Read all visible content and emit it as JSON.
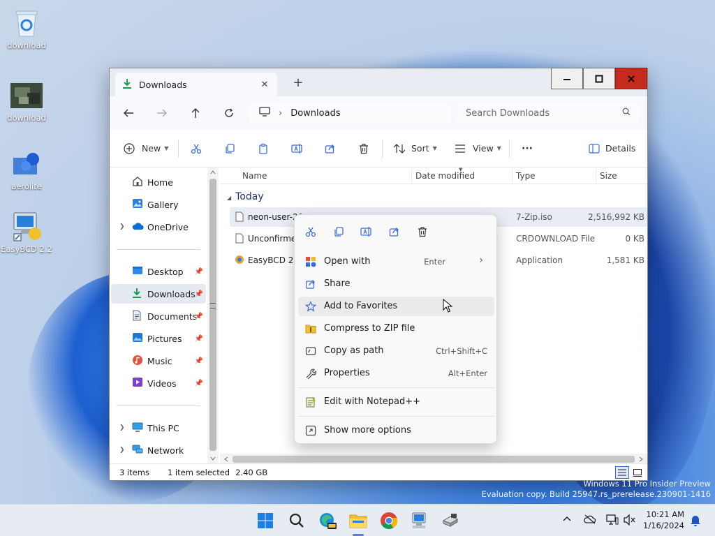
{
  "desktop": {
    "icons": [
      {
        "label": "download"
      },
      {
        "label": "download"
      },
      {
        "label": "aerolite"
      },
      {
        "label": "EasyBCD 2.2"
      }
    ],
    "watermark_line1": "Windows 11 Pro Insider Preview",
    "watermark_line2": "Evaluation copy. Build 25947.rs_prerelease.230901-1416"
  },
  "window": {
    "tab_title": "Downloads",
    "new_tab_label": "+",
    "address": {
      "crumb": "Downloads",
      "separator": "›"
    },
    "search": {
      "placeholder": "Search Downloads"
    },
    "toolbar": {
      "new_label": "New",
      "sort_label": "Sort",
      "view_label": "View",
      "more_label": "···",
      "details_label": "Details"
    },
    "nav_pane": {
      "items": [
        {
          "label": "Home"
        },
        {
          "label": "Gallery"
        },
        {
          "label": "OneDrive"
        },
        {
          "label": "Desktop"
        },
        {
          "label": "Downloads"
        },
        {
          "label": "Documents"
        },
        {
          "label": "Pictures"
        },
        {
          "label": "Music"
        },
        {
          "label": "Videos"
        },
        {
          "label": "This PC"
        },
        {
          "label": "Network"
        }
      ]
    },
    "columns": {
      "name": "Name",
      "date": "Date modified",
      "type": "Type",
      "size": "Size"
    },
    "group": "Today",
    "files": [
      {
        "name": "neon-user-20",
        "type": "7-Zip.iso",
        "size": "2,516,992 KB"
      },
      {
        "name": "Unconfirmed",
        "type": "CRDOWNLOAD File",
        "size": "0 KB"
      },
      {
        "name": "EasyBCD 2.2",
        "type": "Application",
        "size": "1,581 KB"
      }
    ],
    "status": {
      "count": "3 items",
      "selected": "1 item selected",
      "size": "2.40 GB"
    }
  },
  "context_menu": {
    "items": [
      {
        "label": "Open with",
        "shortcut": "Enter"
      },
      {
        "label": "Share",
        "shortcut": ""
      },
      {
        "label": "Add to Favorites",
        "shortcut": ""
      },
      {
        "label": "Compress to ZIP file",
        "shortcut": ""
      },
      {
        "label": "Copy as path",
        "shortcut": "Ctrl+Shift+C"
      },
      {
        "label": "Properties",
        "shortcut": "Alt+Enter"
      },
      {
        "label": "Edit with Notepad++",
        "shortcut": ""
      },
      {
        "label": "Show more options",
        "shortcut": ""
      }
    ]
  },
  "taskbar": {
    "time": "10:21 AM",
    "date": "1/16/2024"
  },
  "colors": {
    "accent": "#0078d4",
    "close_red": "#c42b1c",
    "folder_yellow": "#f4c033",
    "download_green": "#1a9e55"
  }
}
